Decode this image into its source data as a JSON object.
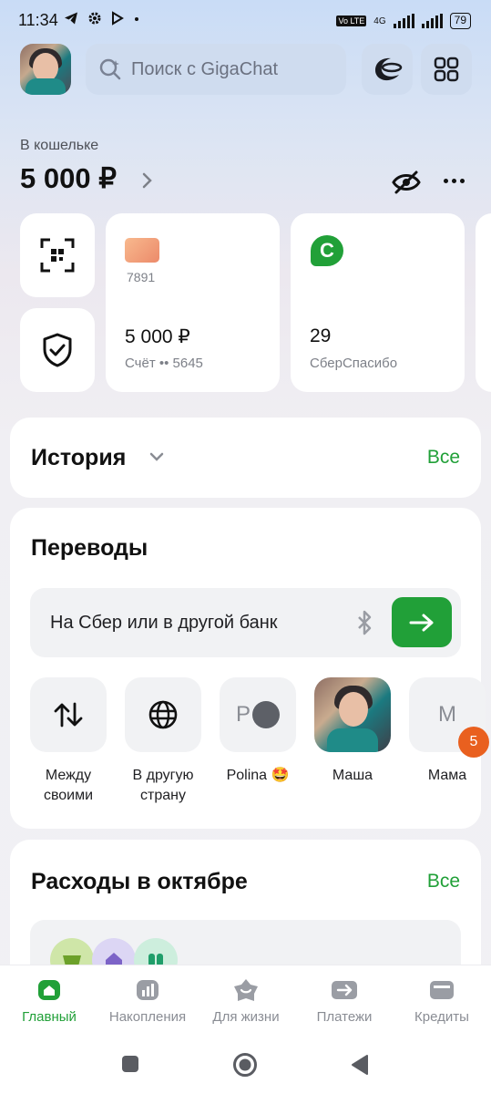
{
  "status_bar": {
    "time": "11:34",
    "volte": "Vo LTE",
    "network": "4G",
    "battery": "79"
  },
  "top": {
    "search_placeholder": "Поиск с GigaChat"
  },
  "wallet": {
    "label": "В кошельке",
    "amount": "5 000 ₽"
  },
  "cards": [
    {
      "last_digits": "7891",
      "balance": "5 000 ₽",
      "subtitle": "Счёт •• 5645"
    },
    {
      "logo": "С",
      "balance": "29",
      "subtitle": "СберСпасибо"
    }
  ],
  "history": {
    "title": "История",
    "all_label": "Все"
  },
  "transfers": {
    "title": "Переводы",
    "input_placeholder": "На Сбер или в другой банк",
    "contacts": [
      {
        "label": "Между своими",
        "icon": "arrows-exchange-icon"
      },
      {
        "label": "В другую страну",
        "icon": "globe-icon"
      },
      {
        "label": "Polina 🤩",
        "initial": "P"
      },
      {
        "label": "Маша",
        "icon": "photo-avatar"
      },
      {
        "label": "Мама",
        "initial": "М",
        "badge": "5"
      }
    ]
  },
  "expenses": {
    "title": "Расходы в октябре",
    "all_label": "Все"
  },
  "bottom_nav": [
    {
      "label": "Главный",
      "icon": "home-icon",
      "active": true
    },
    {
      "label": "Накопления",
      "icon": "chart-icon",
      "active": false
    },
    {
      "label": "Для жизни",
      "icon": "lifestyle-icon",
      "active": false
    },
    {
      "label": "Платежи",
      "icon": "payments-icon",
      "active": false
    },
    {
      "label": "Кредиты",
      "icon": "wallet-icon",
      "active": false
    }
  ],
  "colors": {
    "accent": "#21a038",
    "badge": "#e9601f"
  }
}
